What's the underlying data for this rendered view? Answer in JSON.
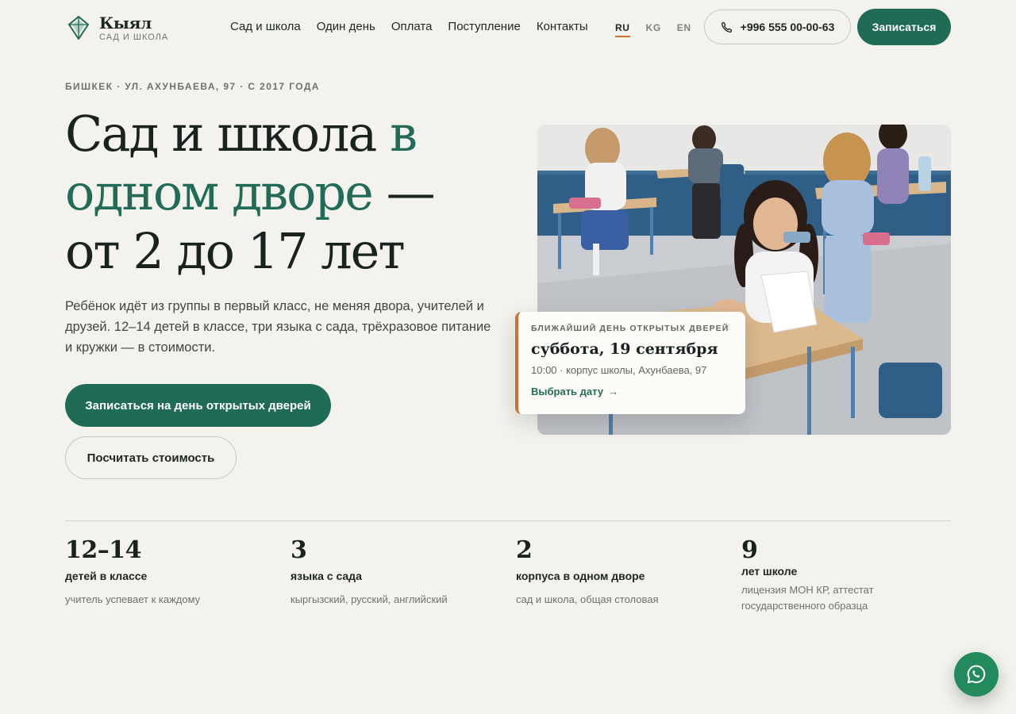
{
  "brand": {
    "name": "Кыял",
    "subtitle": "САД И ШКОЛА"
  },
  "nav": [
    "Сад и школа",
    "Один день",
    "Оплата",
    "Поступление",
    "Контакты"
  ],
  "languages": [
    {
      "code": "RU",
      "active": true
    },
    {
      "code": "KG",
      "active": false
    },
    {
      "code": "EN",
      "active": false
    }
  ],
  "phone": "+996 555 00-00-63",
  "header_cta": "Записаться",
  "hero": {
    "eyebrow": "БИШКЕК · УЛ. АХУНБАЕВА, 97 · С 2017 ГОДА",
    "title_line1": "Сад и школа ",
    "title_line1_accent": "в",
    "title_line2_accent": "одном дворе",
    "title_line2_rest": " —",
    "title_line3": "от 2 до 17 лет",
    "lead": "Ребёнок идёт из группы в первый класс, не меняя двора, учителей и друзей. 12–14 детей в классе, три языка с сада, трёхразовое питание и кружки — в стоимости.",
    "primary_button": "Записаться на день открытых дверей",
    "secondary_button": "Посчитать стоимость"
  },
  "event": {
    "eyebrow": "БЛИЖАЙШИЙ ДЕНЬ ОТКРЫТЫХ ДВЕРЕЙ",
    "date": "суббота, 19 сентября",
    "details": "10:00 · корпус школы, Ахунбаева, 97",
    "link": "Выбрать дату",
    "link_arrow": "→"
  },
  "stats": [
    {
      "value": "12–14",
      "label": "детей в классе",
      "desc": "учитель успевает к каждому"
    },
    {
      "value": "3",
      "label": "языка с сада",
      "desc": "кыргызский, русский, английский"
    },
    {
      "value": "2",
      "label": "корпуса в одном дворе",
      "desc": "сад и школа, общая столовая"
    },
    {
      "value": "9",
      "label": "лет школе",
      "desc": "лицензия МОН КР, аттестат государственного образца"
    }
  ],
  "colors": {
    "background": "#f4f2ed",
    "brand": "#1f6b55",
    "accent_orange": "#d0712b",
    "whatsapp": "#238a5c"
  }
}
